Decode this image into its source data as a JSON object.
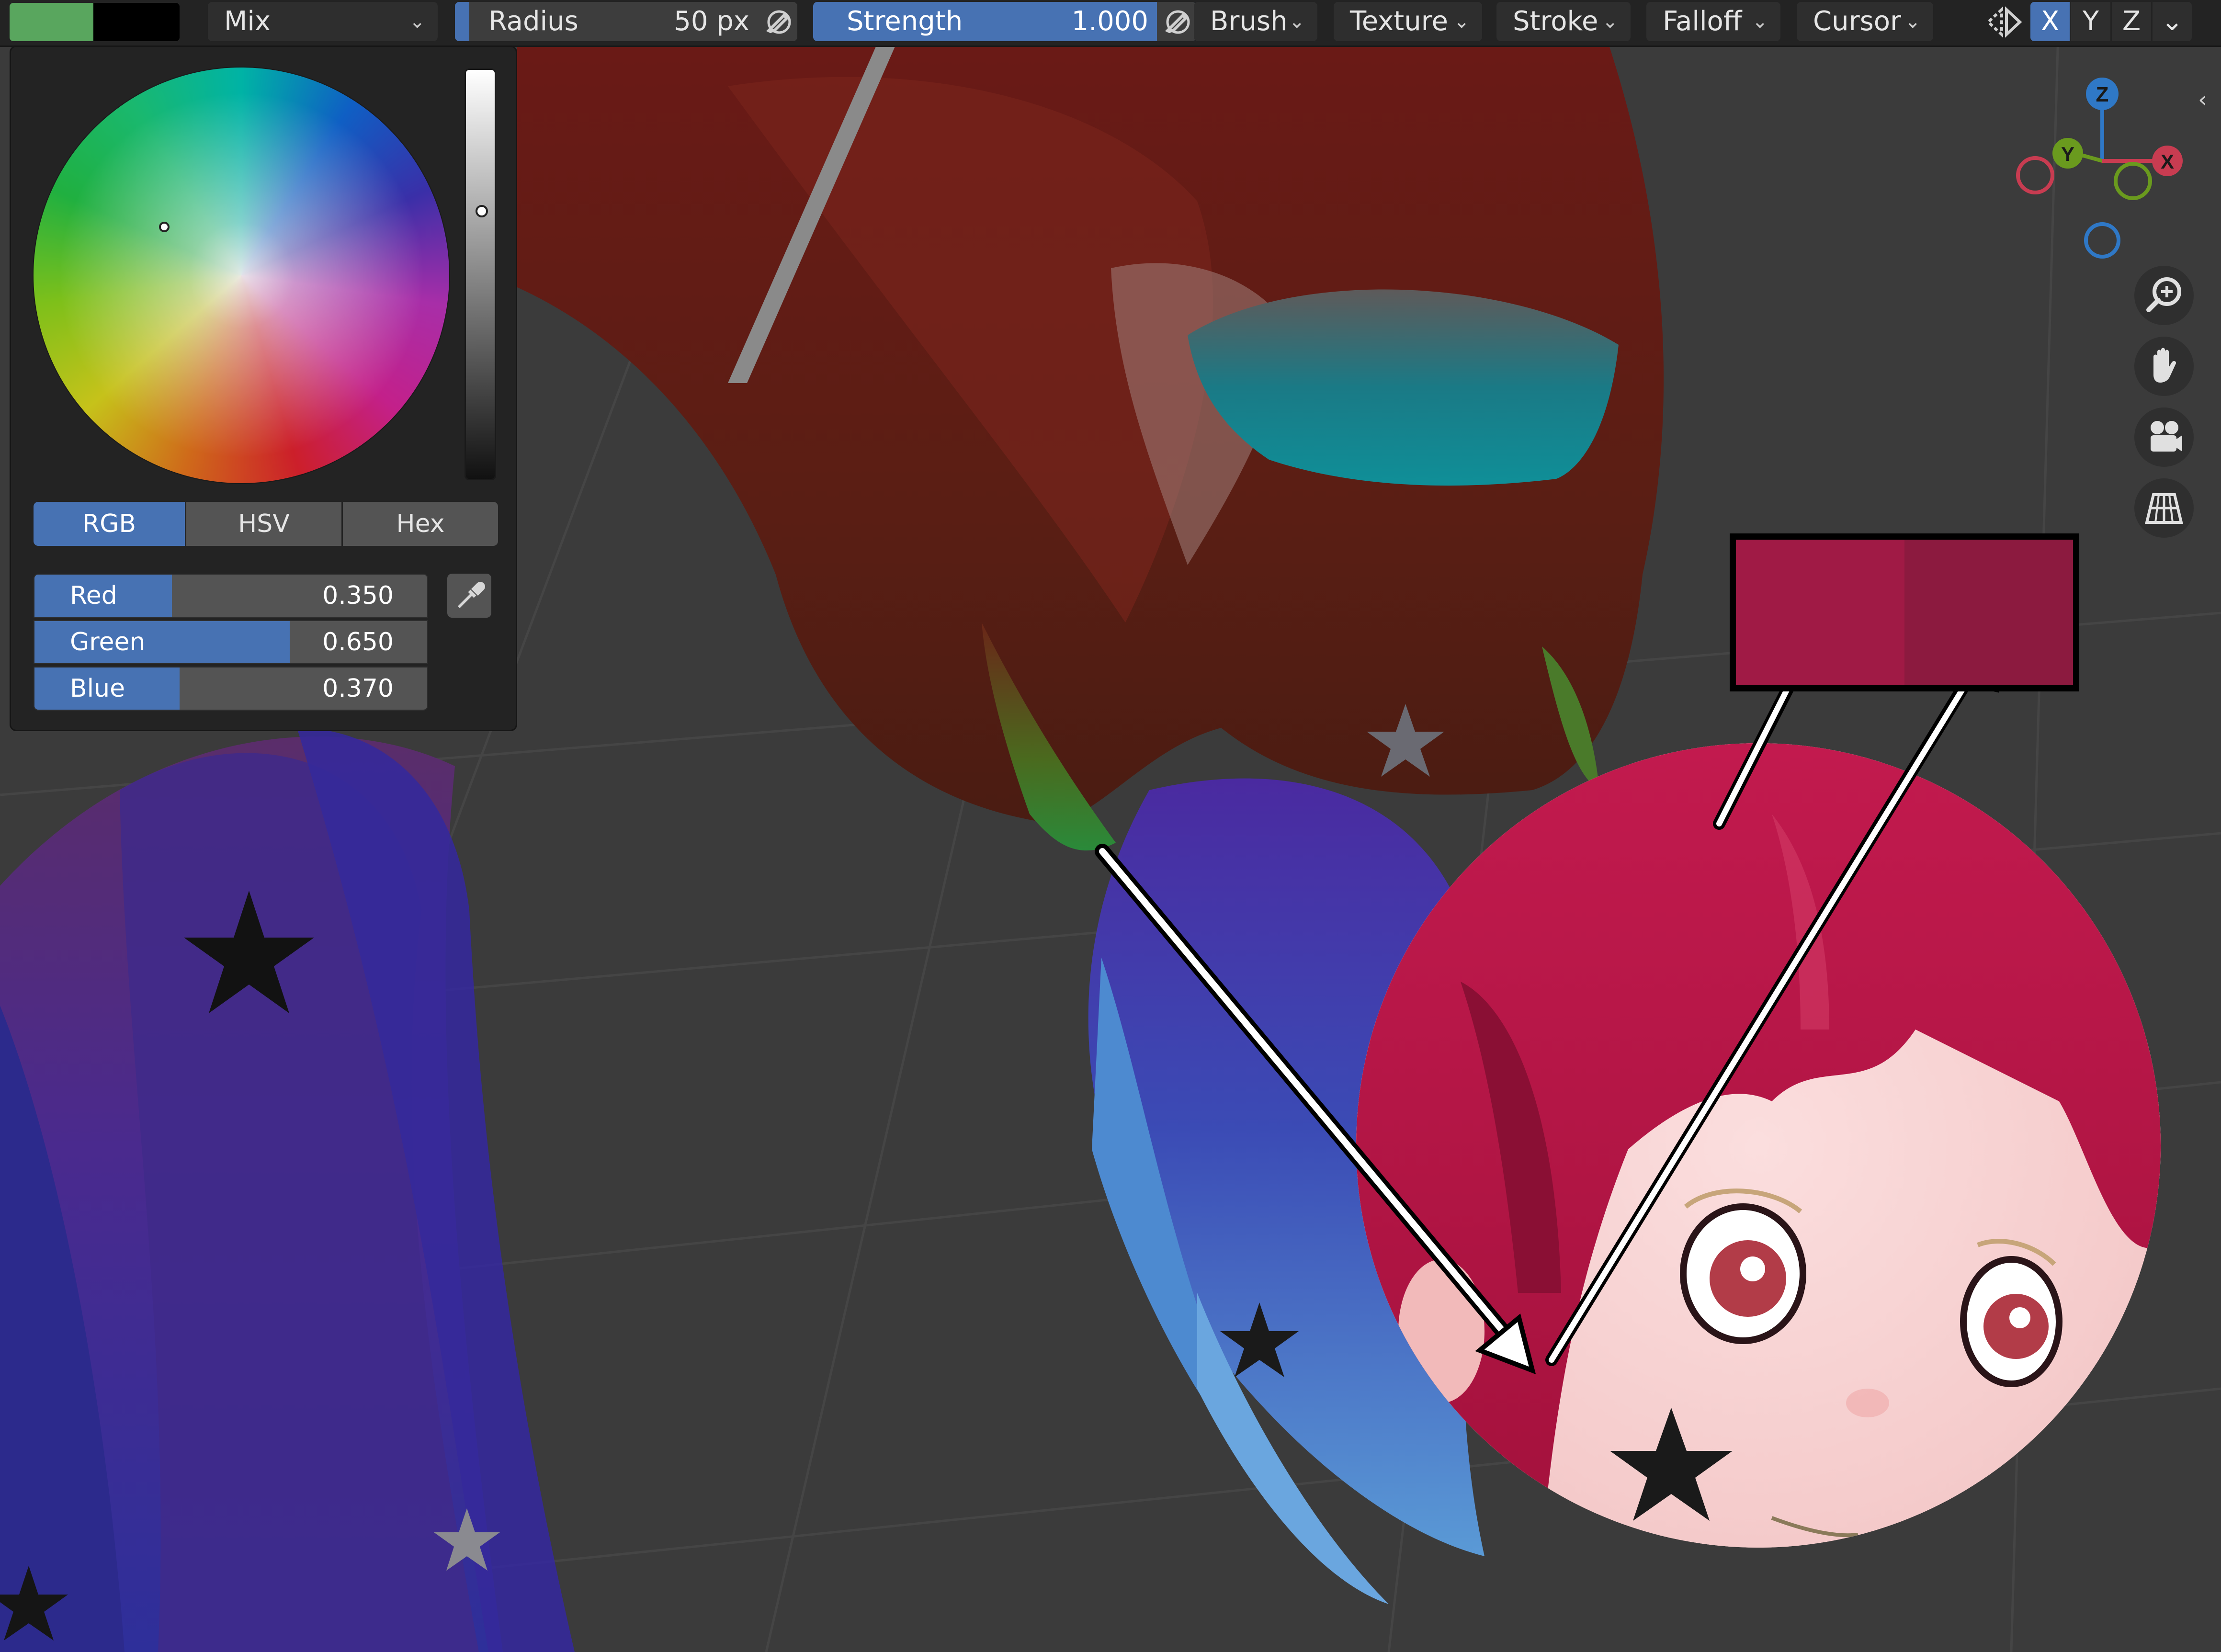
{
  "header": {
    "color_primary": "#59a65e",
    "color_secondary": "#000000",
    "blend_mode": "Mix",
    "radius_label": "Radius",
    "radius_value": "50 px",
    "strength_label": "Strength",
    "strength_value": "1.000",
    "menus": [
      "Brush",
      "Texture",
      "Stroke",
      "Falloff",
      "Cursor"
    ],
    "symmetry_axes": [
      "X",
      "Y",
      "Z"
    ],
    "active_axis": "X"
  },
  "color_picker": {
    "tabs": [
      "RGB",
      "HSV",
      "Hex"
    ],
    "active_tab": "RGB",
    "channels": [
      {
        "name": "Red",
        "value": "0.350",
        "fraction": 0.35
      },
      {
        "name": "Green",
        "value": "0.650",
        "fraction": 0.65
      },
      {
        "name": "Blue",
        "value": "0.370",
        "fraction": 0.37
      }
    ]
  },
  "gizmo": {
    "axes": [
      "Z",
      "Y",
      "X"
    ],
    "colors": {
      "x": "#c83c51",
      "y": "#6a9a1e",
      "z": "#2f78c6"
    }
  },
  "navigation": [
    "zoom-icon",
    "hand-icon",
    "camera-icon",
    "grid-icon"
  ],
  "overlay": {
    "swatch_colors": [
      "#a01a45",
      "#8c1a3f"
    ]
  }
}
